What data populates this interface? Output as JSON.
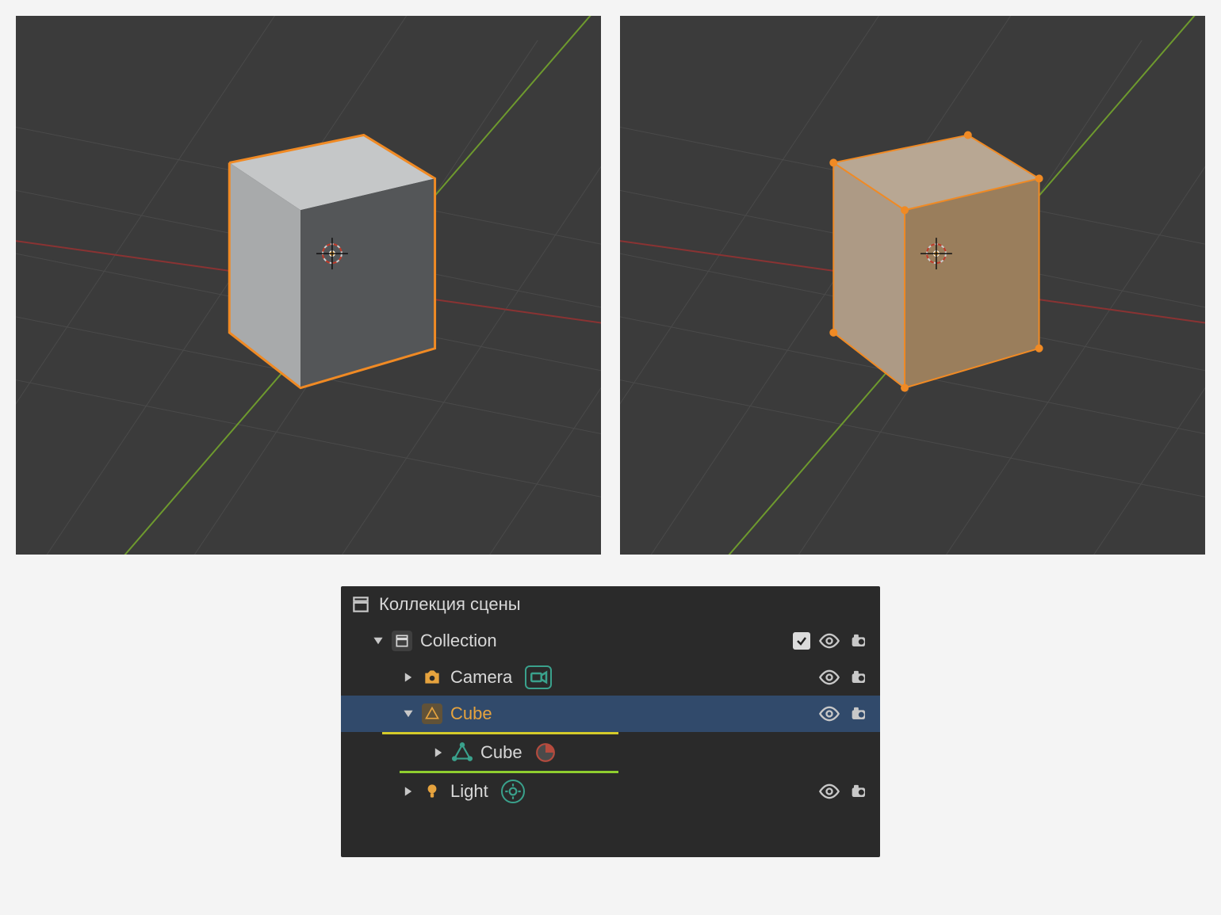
{
  "viewport_left": {
    "mode_desc": "object-mode-cube-solid"
  },
  "viewport_right": {
    "mode_desc": "edit-mode-cube-wire"
  },
  "outliner": {
    "scene_collection_label": "Коллекция сцены",
    "collection_label": "Collection",
    "items": {
      "camera": {
        "label": "Camera"
      },
      "cube": {
        "label": "Cube"
      },
      "mesh": {
        "label": "Cube"
      },
      "light": {
        "label": "Light"
      }
    },
    "colors": {
      "accent_orange": "#e6a33e",
      "accent_teal": "#3aa18c",
      "selected_row": "#314a6b"
    }
  }
}
